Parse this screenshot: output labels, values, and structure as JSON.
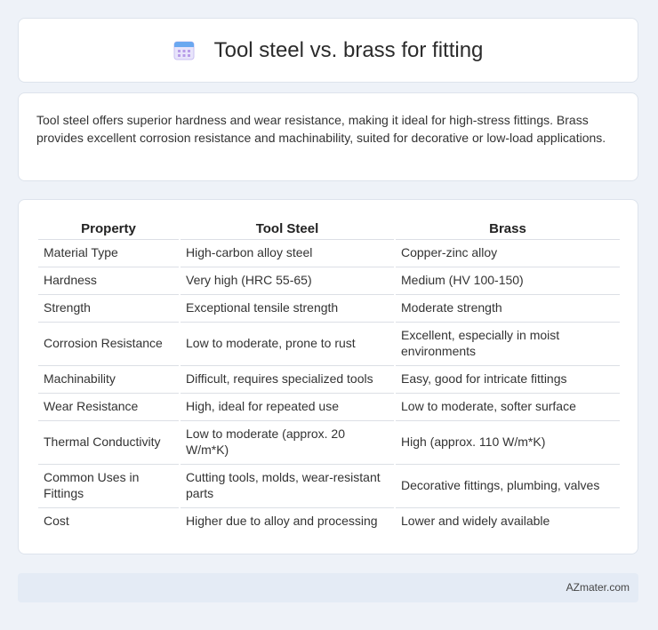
{
  "header": {
    "title": "Tool steel vs. brass for fitting",
    "icon": "calendar-icon"
  },
  "summary": "Tool steel offers superior hardness and wear resistance, making it ideal for high-stress fittings. Brass provides excellent corrosion resistance and machinability, suited for decorative or low-load applications.",
  "table": {
    "headers": [
      "Property",
      "Tool Steel",
      "Brass"
    ],
    "rows": [
      [
        "Material Type",
        "High-carbon alloy steel",
        "Copper-zinc alloy"
      ],
      [
        "Hardness",
        "Very high (HRC 55-65)",
        "Medium (HV 100-150)"
      ],
      [
        "Strength",
        "Exceptional tensile strength",
        "Moderate strength"
      ],
      [
        "Corrosion Resistance",
        "Low to moderate, prone to rust",
        "Excellent, especially in moist environments"
      ],
      [
        "Machinability",
        "Difficult, requires specialized tools",
        "Easy, good for intricate fittings"
      ],
      [
        "Wear Resistance",
        "High, ideal for repeated use",
        "Low to moderate, softer surface"
      ],
      [
        "Thermal Conductivity",
        "Low to moderate (approx. 20 W/m*K)",
        "High (approx. 110 W/m*K)"
      ],
      [
        "Common Uses in Fittings",
        "Cutting tools, molds, wear-resistant parts",
        "Decorative fittings, plumbing, valves"
      ],
      [
        "Cost",
        "Higher due to alloy and processing",
        "Lower and widely available"
      ]
    ]
  },
  "footer": {
    "brand": "AZmater.com"
  }
}
